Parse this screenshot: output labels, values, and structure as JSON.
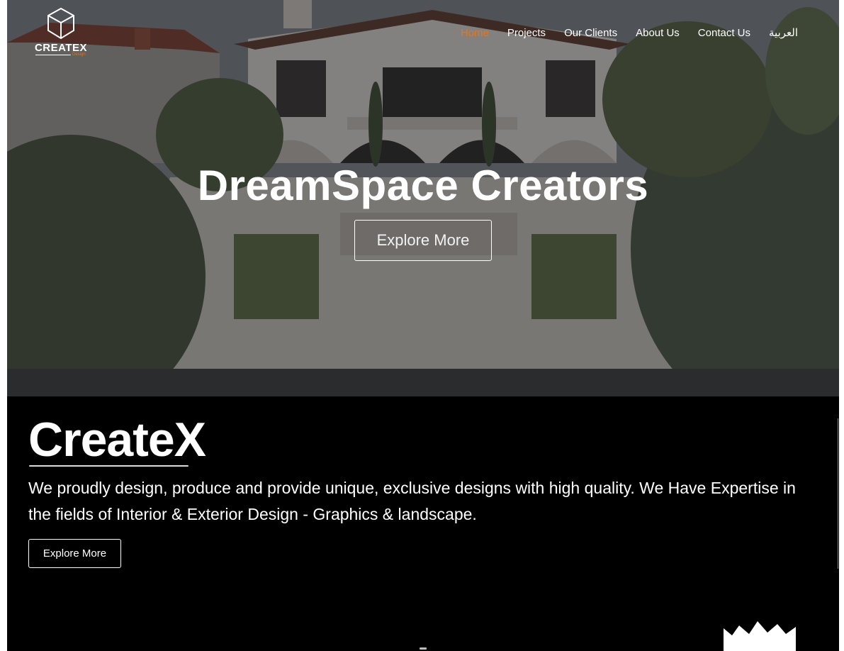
{
  "brand": {
    "logo_word": "CREATEX",
    "logo_sub": "Design",
    "accent_color": "#e2771f",
    "logo_icon": "cube-icon"
  },
  "nav": {
    "items": [
      {
        "label": "Home",
        "active": true
      },
      {
        "label": "Projects",
        "active": false
      },
      {
        "label": "Our Clients",
        "active": false
      },
      {
        "label": "About Us",
        "active": false
      },
      {
        "label": "Contact Us",
        "active": false
      },
      {
        "label": "العربية",
        "active": false
      }
    ]
  },
  "hero": {
    "title": "DreamSpace Creators",
    "button_label": "Explore More",
    "background": "aerial-villa-photo"
  },
  "about": {
    "title": "CreateX",
    "description": "We proudly design, produce and provide unique, exclusive designs with high quality. We Have Expertise in the fields of Interior & Exterior Design - Graphics & landscape.",
    "button_label": "Explore More"
  }
}
